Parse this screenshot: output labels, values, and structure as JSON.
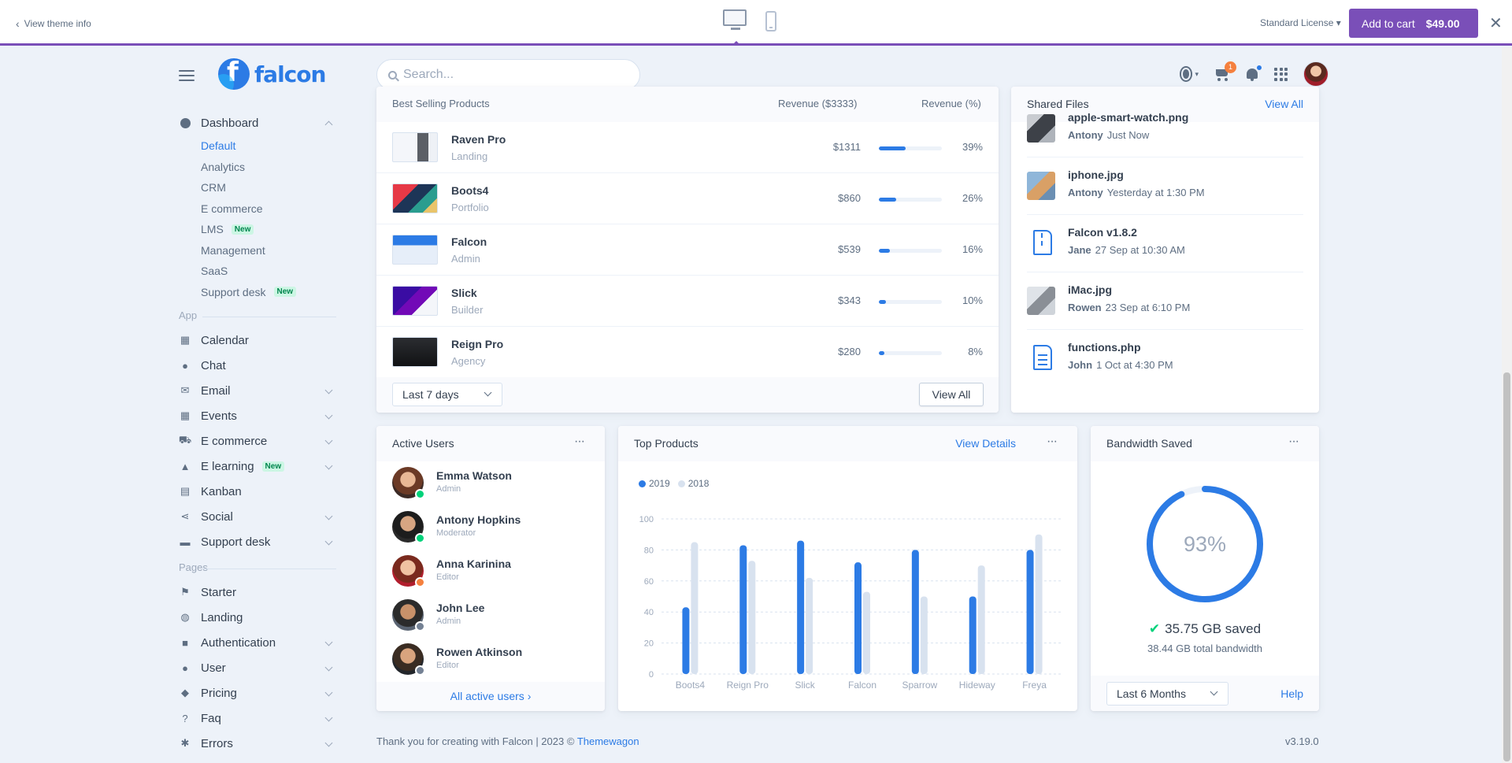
{
  "themebar": {
    "back_label": "View theme info",
    "license_label": "Standard License",
    "cart_label": "Add to cart",
    "cart_price": "$49.00"
  },
  "header": {
    "logo_text": "falcon",
    "search_placeholder": "Search...",
    "cart_badge": "1"
  },
  "sidebar": {
    "dashboard_label": "Dashboard",
    "dashboard_items": [
      {
        "label": "Default",
        "active": true
      },
      {
        "label": "Analytics"
      },
      {
        "label": "CRM"
      },
      {
        "label": "E commerce"
      },
      {
        "label": "LMS",
        "badge": "New"
      },
      {
        "label": "Management"
      },
      {
        "label": "SaaS"
      },
      {
        "label": "Support desk",
        "badge": "New"
      }
    ],
    "app_label": "App",
    "app_items": [
      {
        "label": "Calendar",
        "icon": "calendar-icon"
      },
      {
        "label": "Chat",
        "icon": "chat-icon"
      },
      {
        "label": "Email",
        "icon": "envelope-icon"
      },
      {
        "label": "Events",
        "icon": "calendar-day-icon"
      },
      {
        "label": "E commerce",
        "icon": "shopping-cart-icon"
      },
      {
        "label": "E learning",
        "icon": "graduation-cap-icon",
        "badge": "New"
      },
      {
        "label": "Kanban",
        "icon": "kanban-icon"
      },
      {
        "label": "Social",
        "icon": "share-icon"
      },
      {
        "label": "Support desk",
        "icon": "ticket-icon"
      }
    ],
    "pages_label": "Pages",
    "pages_items": [
      {
        "label": "Starter",
        "icon": "flag-icon"
      },
      {
        "label": "Landing",
        "icon": "globe-icon"
      },
      {
        "label": "Authentication",
        "icon": "lock-icon"
      },
      {
        "label": "User",
        "icon": "user-icon"
      },
      {
        "label": "Pricing",
        "icon": "tags-icon"
      },
      {
        "label": "Faq",
        "icon": "question-circle-icon"
      },
      {
        "label": "Errors",
        "icon": "bug-icon"
      }
    ]
  },
  "best_selling": {
    "title": "Best Selling Products",
    "col_revenue": "Revenue ($3333)",
    "col_revenue_pct": "Revenue (%)",
    "rows": [
      {
        "name": "Raven Pro",
        "category": "Landing",
        "revenue": "$1311",
        "percent": "39%",
        "fraction": 0.39
      },
      {
        "name": "Boots4",
        "category": "Portfolio",
        "revenue": "$860",
        "percent": "26%",
        "fraction": 0.26
      },
      {
        "name": "Falcon",
        "category": "Admin",
        "revenue": "$539",
        "percent": "16%",
        "fraction": 0.16
      },
      {
        "name": "Slick",
        "category": "Builder",
        "revenue": "$343",
        "percent": "10%",
        "fraction": 0.1
      },
      {
        "name": "Reign Pro",
        "category": "Agency",
        "revenue": "$280",
        "percent": "8%",
        "fraction": 0.08
      }
    ],
    "range_select": "Last 7 days",
    "view_all": "View All"
  },
  "shared_files": {
    "title": "Shared Files",
    "view_all": "View All",
    "files": [
      {
        "name": "apple-smart-watch.png",
        "user": "Antony",
        "time": "Just Now",
        "kind": "image"
      },
      {
        "name": "iphone.jpg",
        "user": "Antony",
        "time": "Yesterday at 1:30 PM",
        "kind": "image"
      },
      {
        "name": "Falcon v1.8.2",
        "user": "Jane",
        "time": "27 Sep at 10:30 AM",
        "kind": "zip"
      },
      {
        "name": "iMac.jpg",
        "user": "Rowen",
        "time": "23 Sep at 6:10 PM",
        "kind": "image"
      },
      {
        "name": "functions.php",
        "user": "John",
        "time": "1 Oct at 4:30 PM",
        "kind": "doc"
      }
    ]
  },
  "active_users": {
    "title": "Active Users",
    "users": [
      {
        "name": "Emma Watson",
        "role": "Admin",
        "status_color": "#00d27a"
      },
      {
        "name": "Antony Hopkins",
        "role": "Moderator",
        "status_color": "#00d27a"
      },
      {
        "name": "Anna Karinina",
        "role": "Editor",
        "status_color": "#f5803e"
      },
      {
        "name": "John Lee",
        "role": "Admin",
        "status_color": "#748194"
      },
      {
        "name": "Rowen Atkinson",
        "role": "Editor",
        "status_color": "#748194"
      }
    ],
    "footer_link": "All active users"
  },
  "top_products": {
    "title": "Top Products",
    "view_details": "View Details"
  },
  "chart_data": {
    "type": "bar",
    "categories": [
      "Boots4",
      "Reign Pro",
      "Slick",
      "Falcon",
      "Sparrow",
      "Hideway",
      "Freya"
    ],
    "series": [
      {
        "name": "2019",
        "color": "#2c7be5",
        "values": [
          43,
          83,
          86,
          72,
          80,
          50,
          80
        ]
      },
      {
        "name": "2018",
        "color": "#d8e2ef",
        "values": [
          85,
          73,
          62,
          53,
          50,
          70,
          90
        ]
      }
    ],
    "yticks": [
      0,
      20,
      40,
      60,
      80,
      100
    ],
    "ylim": [
      0,
      100
    ],
    "grid": true,
    "legend": "top-left"
  },
  "bandwidth": {
    "title": "Bandwidth Saved",
    "percent_label": "93%",
    "percent_value": 0.93,
    "saved_label": "35.75 GB saved",
    "total_label": "38.44 GB total bandwidth",
    "range_select": "Last 6 Months",
    "help_label": "Help"
  },
  "footer": {
    "text": "Thank you for creating with Falcon | 2023 ©",
    "link": "Themewagon",
    "version": "v3.19.0"
  }
}
